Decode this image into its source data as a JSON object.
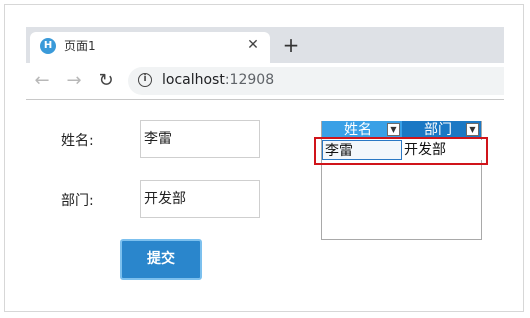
{
  "browser": {
    "tab_title": "页面1",
    "tab_favicon_letter": "H",
    "url_host": "localhost",
    "url_port": ":12908"
  },
  "form": {
    "name_label": "姓名:",
    "name_value": "李雷",
    "dept_label": "部门:",
    "dept_value": "开发部",
    "submit_label": "提交"
  },
  "grid": {
    "columns": [
      "姓名",
      "部门"
    ],
    "rows": [
      [
        "李雷",
        "开发部"
      ]
    ]
  },
  "colors": {
    "header_left": "#3aa0e6",
    "header_right": "#1b78c4",
    "submit": "#2a86cc",
    "highlight": "#d0141a"
  }
}
